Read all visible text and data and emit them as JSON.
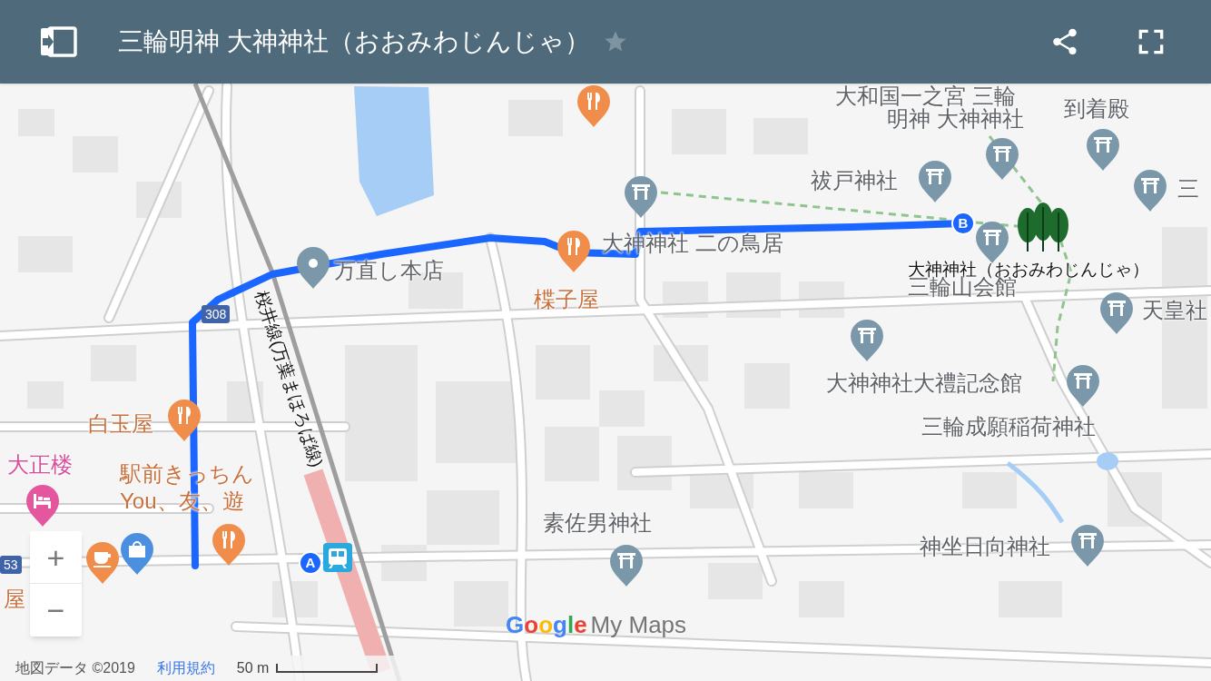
{
  "header": {
    "title": "三輪明神 大神神社（おおみわじんじゃ）",
    "starred": false
  },
  "map": {
    "labels": [
      {
        "text": "大和国一之宮 三輪",
        "kind": "place"
      },
      {
        "text": "明神 大神神社",
        "kind": "place"
      },
      {
        "text": "到着殿",
        "kind": "place"
      },
      {
        "text": "祓戸神社",
        "kind": "place"
      },
      {
        "text": "三",
        "kind": "place"
      },
      {
        "text": "大神神社 二の鳥居",
        "kind": "place"
      },
      {
        "text": "万直し本店",
        "kind": "place"
      },
      {
        "text": "楪子屋",
        "kind": "food"
      },
      {
        "text": "大神神社（おおみわじんじゃ）",
        "kind": "marker"
      },
      {
        "text": "三輪山会館",
        "kind": "place"
      },
      {
        "text": "天皇社",
        "kind": "place"
      },
      {
        "text": "大神神社大禮記念館",
        "kind": "place"
      },
      {
        "text": "三輪成願稲荷神社",
        "kind": "place"
      },
      {
        "text": "素佐男神社",
        "kind": "place"
      },
      {
        "text": "神坐日向神社",
        "kind": "place"
      },
      {
        "text": "白玉屋",
        "kind": "food"
      },
      {
        "text": "大正楼",
        "kind": "hotel"
      },
      {
        "text": "駅前きっちん",
        "kind": "food"
      },
      {
        "text": "You、友、遊",
        "kind": "food"
      },
      {
        "text": "屋",
        "kind": "food"
      },
      {
        "text": "桜井線(万葉まほろば線)",
        "kind": "rail"
      }
    ],
    "road_shields": [
      "308",
      "53"
    ],
    "markers": [
      "A",
      "B"
    ],
    "zoom_in": "+",
    "zoom_out": "−",
    "logo": {
      "brand": "Google",
      "product": "My Maps"
    },
    "footer": {
      "attribution": "地図データ ©2019",
      "terms": "利用規約",
      "scale": "50 m"
    }
  }
}
